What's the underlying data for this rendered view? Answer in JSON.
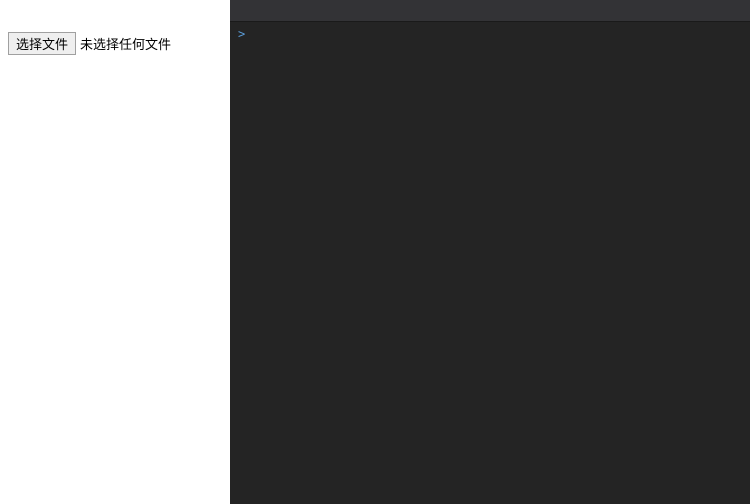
{
  "left": {
    "choose_file_label": "选择文件",
    "no_file_text": "未选择任何文件"
  },
  "console": {
    "prompt": ">"
  }
}
